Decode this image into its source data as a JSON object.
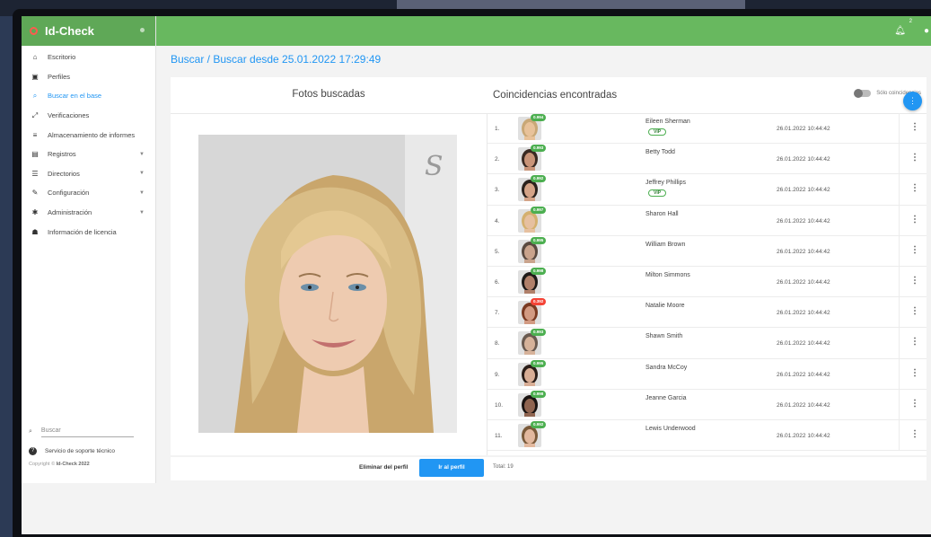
{
  "app": {
    "brand": "Id-Check",
    "notifications_count": "2"
  },
  "sidebar": {
    "items": [
      {
        "label": "Escritorio",
        "icon": "home-icon",
        "glyph": "⌂"
      },
      {
        "label": "Perfiles",
        "icon": "id-card-icon",
        "glyph": "▣"
      },
      {
        "label": "Buscar en el base",
        "icon": "search-icon",
        "glyph": "⌕",
        "active": true
      },
      {
        "label": "Verificaciones",
        "icon": "expand-arrows-icon",
        "glyph": "⤢"
      },
      {
        "label": "Almacenamiento de informes",
        "icon": "list-icon",
        "glyph": "≡"
      },
      {
        "label": "Registros",
        "icon": "table-icon",
        "glyph": "▤",
        "has_submenu": true
      },
      {
        "label": "Directorios",
        "icon": "list-icon",
        "glyph": "☰",
        "has_submenu": true
      },
      {
        "label": "Configuración",
        "icon": "wrench-icon",
        "glyph": "✎",
        "has_submenu": true
      },
      {
        "label": "Administración",
        "icon": "gear-icon",
        "glyph": "✱",
        "has_submenu": true
      },
      {
        "label": "Información de licencia",
        "icon": "license-icon",
        "glyph": "☗"
      }
    ],
    "search_placeholder": "Buscar",
    "support_label": "Servicio de soporte técnico",
    "copyright_prefix": "Copyright ©",
    "copyright_brand": "Id-Check 2022"
  },
  "breadcrumb": "Buscar / Buscar desde 25.01.2022 17:29:49",
  "panel": {
    "left_title": "Fotos buscadas",
    "right_title": "Coincidencias encontradas",
    "toggle_label": "Sólo coincidencias"
  },
  "matches": [
    {
      "num": "1.",
      "score": "0.994",
      "score_color": "green",
      "name": "Eileen Sherman",
      "vip": "VIP",
      "date": "26.01.2022 10:44:42",
      "skin": "#e8c29a",
      "hair": "#c9a877"
    },
    {
      "num": "2.",
      "score": "0.993",
      "score_color": "green",
      "name": "Betty Todd",
      "vip": "",
      "date": "26.01.2022 10:44:42",
      "skin": "#c99478",
      "hair": "#3a2a22"
    },
    {
      "num": "3.",
      "score": "0.992",
      "score_color": "green",
      "name": "Jeffrey Phillips",
      "vip": "VIP",
      "date": "26.01.2022 10:44:42",
      "skin": "#d4a387",
      "hair": "#2b221d"
    },
    {
      "num": "4.",
      "score": "0.997",
      "score_color": "green",
      "name": "Sharon Hall",
      "vip": "",
      "date": "26.01.2022 10:44:42",
      "skin": "#e6c0a0",
      "hair": "#d4b06f"
    },
    {
      "num": "5.",
      "score": "0.995",
      "score_color": "green",
      "name": "William Brown",
      "vip": "",
      "date": "26.01.2022 10:44:42",
      "skin": "#c9a38c",
      "hair": "#5a4a40"
    },
    {
      "num": "6.",
      "score": "0.998",
      "score_color": "green",
      "name": "Milton Simmons",
      "vip": "",
      "date": "26.01.2022 10:44:42",
      "skin": "#b0806a",
      "hair": "#1e1a18"
    },
    {
      "num": "7.",
      "score": "0.392",
      "score_color": "red",
      "name": "Natalie Moore",
      "vip": "",
      "date": "26.01.2022 10:44:42",
      "skin": "#d29a82",
      "hair": "#7a3a22"
    },
    {
      "num": "8.",
      "score": "0.993",
      "score_color": "green",
      "name": "Shawn Smith",
      "vip": "",
      "date": "26.01.2022 10:44:42",
      "skin": "#d6b29a",
      "hair": "#6a5a50"
    },
    {
      "num": "9.",
      "score": "0.995",
      "score_color": "green",
      "name": "Sandra McCoy",
      "vip": "",
      "date": "26.01.2022 10:44:42",
      "skin": "#d8ad95",
      "hair": "#2a1d18"
    },
    {
      "num": "10.",
      "score": "0.998",
      "score_color": "green",
      "name": "Jeanne Garcia",
      "vip": "",
      "date": "26.01.2022 10:44:42",
      "skin": "#8f6450",
      "hair": "#1a1412"
    },
    {
      "num": "11.",
      "score": "0.992",
      "score_color": "green",
      "name": "Lewis Underwood",
      "vip": "",
      "date": "26.01.2022 10:44:42",
      "skin": "#e2b89e",
      "hair": "#7a5a3a"
    }
  ],
  "footer": {
    "delete_label": "Eliminar del perfil",
    "go_label": "Ir al perfil",
    "total": "Total: 19"
  },
  "colors": {
    "topbar": "#68b85f",
    "accent": "#2196f3",
    "score_green": "#4caf50",
    "score_red": "#f44336"
  }
}
